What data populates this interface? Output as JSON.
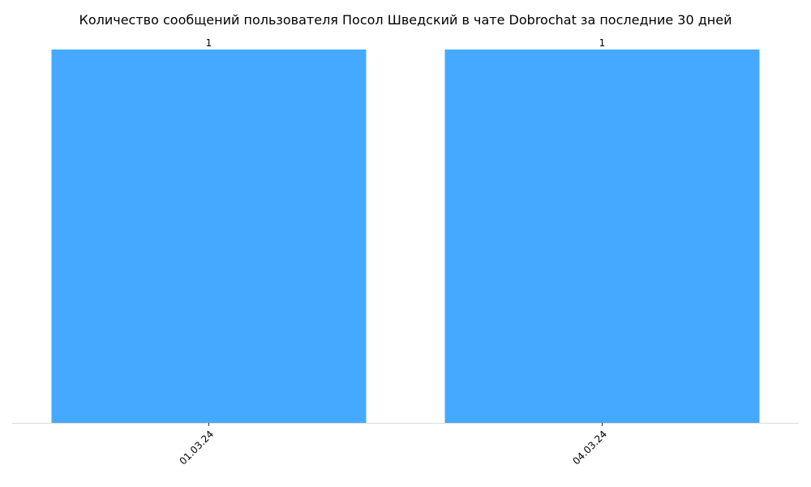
{
  "chart_data": {
    "type": "bar",
    "title": "Количество сообщений пользователя Посол Шведский в чате Dobrochat за последние 30 дней",
    "xlabel": "",
    "ylabel": "",
    "categories": [
      "01.03.24",
      "04.03.24"
    ],
    "values": [
      1,
      1
    ],
    "data_labels": [
      "1",
      "1"
    ],
    "ylim": [
      0,
      1.05
    ],
    "grid": false,
    "legend": "none",
    "x_tick_rotation_deg": 45
  },
  "colors": {
    "bar": "#45aaff",
    "axis": "#dddddd",
    "text": "#000000",
    "background": "#ffffff"
  }
}
